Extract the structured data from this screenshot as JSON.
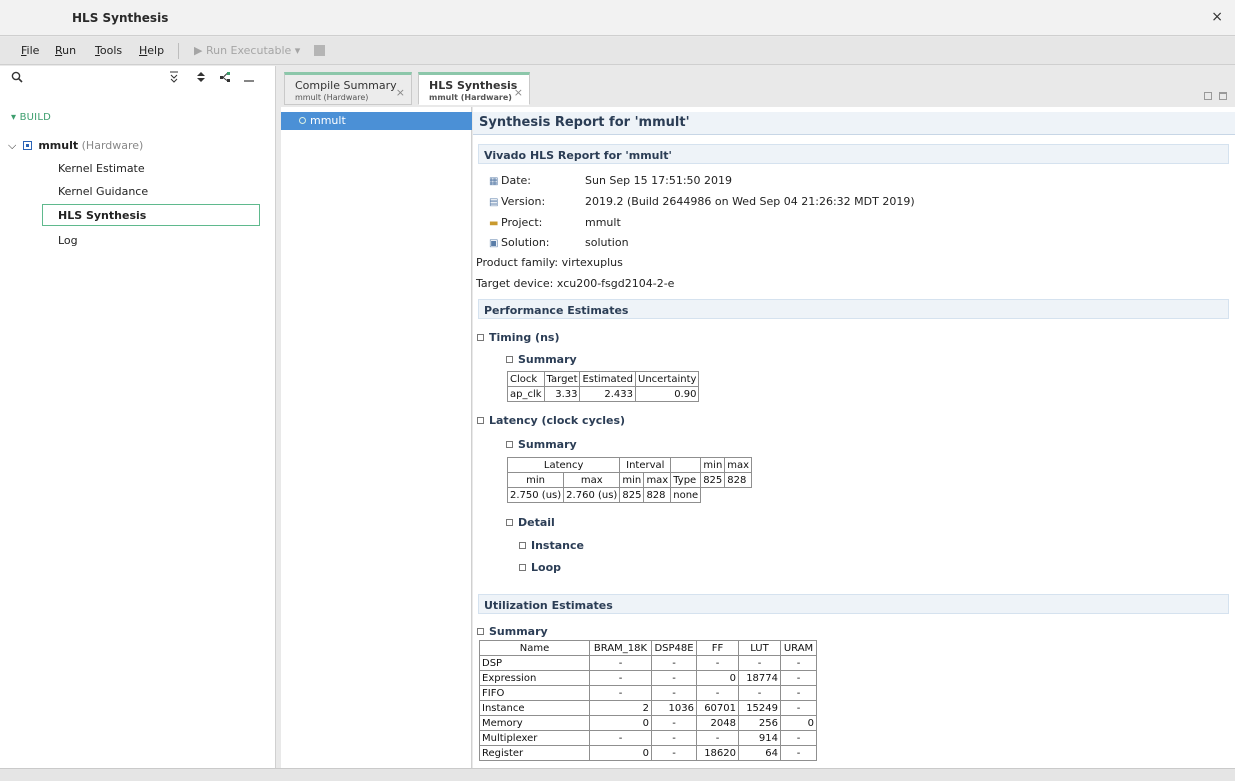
{
  "window": {
    "title": "HLS Synthesis",
    "close_glyph": "×"
  },
  "menu": {
    "items": [
      {
        "label": "File",
        "mnemonic": "F",
        "rest": "ile"
      },
      {
        "label": "Run",
        "mnemonic": "R",
        "rest": "un"
      },
      {
        "label": "Tools",
        "mnemonic": "T",
        "rest": "ools"
      },
      {
        "label": "Help",
        "mnemonic": "H",
        "rest": "elp"
      }
    ],
    "run_executable": "▶ Run Executable  ▾"
  },
  "left_pane": {
    "toolbar_icons": [
      "search-icon",
      "collapse-all-icon",
      "expand-all-icon",
      "link-icon",
      "minimize-icon"
    ],
    "section": "▾ BUILD",
    "root": {
      "label": "mmult",
      "suffix": "(Hardware)"
    },
    "items": [
      "Kernel Estimate",
      "Kernel Guidance",
      "HLS Synthesis",
      "Log"
    ]
  },
  "tabs": [
    {
      "title": "Compile Summary",
      "subtitle": "mmult (Hardware)",
      "close": "×"
    },
    {
      "title": "HLS Synthesis",
      "subtitle": "mmult (Hardware)",
      "close": "×"
    }
  ],
  "nav": {
    "selected": "mmult"
  },
  "report": {
    "title": "Synthesis Report for 'mmult'",
    "vivado_header": "Vivado HLS Report for 'mmult'",
    "info": [
      {
        "key": "Date:",
        "value": "Sun Sep 15 17:51:50 2019",
        "icon": "calendar-icon"
      },
      {
        "key": "Version:",
        "value": "2019.2 (Build 2644986 on Wed Sep 04 21:26:32 MDT 2019)",
        "icon": "version-icon"
      },
      {
        "key": "Project:",
        "value": "mmult",
        "icon": "folder-icon"
      },
      {
        "key": "Solution:",
        "value": "solution",
        "icon": "solution-icon"
      },
      {
        "key": "Product family:",
        "value": "virtexuplus"
      },
      {
        "key": "Target device:",
        "value": "xcu200-fsgd2104-2-e"
      }
    ],
    "perf_header": "Performance Estimates",
    "timing_label": "Timing (ns)",
    "summary_label": "Summary",
    "timing_table": {
      "headers": [
        "Clock",
        "Target",
        "Estimated",
        "Uncertainty"
      ],
      "row": [
        "ap_clk",
        "3.33",
        "2.433",
        "0.90"
      ]
    },
    "latency_label": "Latency (clock cycles)",
    "latency_table": {
      "h1": [
        "Latency",
        "Interval",
        "",
        "min",
        "max"
      ],
      "h2": [
        "min",
        "max",
        "min",
        "max",
        "Type",
        "825",
        "828"
      ],
      "row": [
        "2.750 (us)",
        "2.760 (us)",
        "825",
        "828",
        "none"
      ]
    },
    "detail_label": "Detail",
    "instance_label": "Instance",
    "loop_label": "Loop",
    "util_header": "Utilization Estimates",
    "util_table": {
      "headers": [
        "Name",
        "BRAM_18K",
        "DSP48E",
        "FF",
        "LUT",
        "URAM"
      ],
      "rows": [
        [
          "DSP",
          "-",
          "-",
          "-",
          "-",
          "-"
        ],
        [
          "Expression",
          "-",
          "-",
          "0",
          "18774",
          "-"
        ],
        [
          "FIFO",
          "-",
          "-",
          "-",
          "-",
          "-"
        ],
        [
          "Instance",
          "2",
          "1036",
          "60701",
          "15249",
          "-"
        ],
        [
          "Memory",
          "0",
          "-",
          "2048",
          "256",
          "0"
        ],
        [
          "Multiplexer",
          "-",
          "-",
          "-",
          "914",
          "-"
        ],
        [
          "Register",
          "0",
          "-",
          "18620",
          "64",
          "-"
        ]
      ]
    }
  }
}
